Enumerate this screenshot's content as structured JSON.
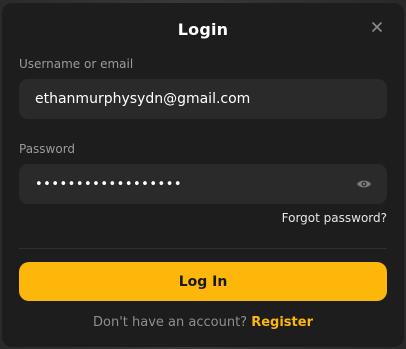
{
  "modal": {
    "title": "Login",
    "close_icon": "close-icon"
  },
  "username": {
    "label": "Username or email",
    "value": "ethanmurphysydn@gmail.com"
  },
  "password": {
    "label": "Password",
    "value": "••••••••••••••••••",
    "toggle_icon": "eye-icon"
  },
  "links": {
    "forgot_password": "Forgot password?",
    "no_account_prompt": "Don't have an account?",
    "register": "Register"
  },
  "actions": {
    "login_label": "Log In"
  },
  "colors": {
    "accent": "#fdb60a",
    "modal_bg": "#1d1d1d",
    "input_bg": "#2a2a2a"
  }
}
